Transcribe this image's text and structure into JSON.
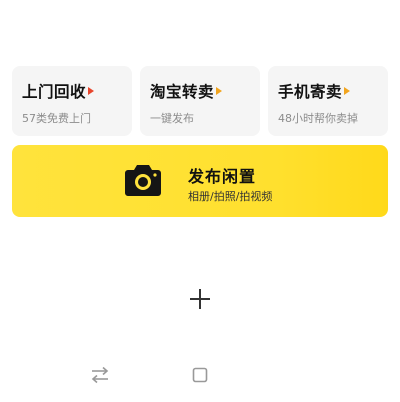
{
  "cards": [
    {
      "title": "上门回收",
      "subtitle": "57类免费上门",
      "icon": "triangle-arrow-icon",
      "color": "#e8452c"
    },
    {
      "title": "淘宝转卖",
      "subtitle": "一键发布",
      "icon": "triangle-arrow-icon",
      "color": "#f2a51f"
    },
    {
      "title": "手机寄卖",
      "subtitle": "48小时帮你卖掉",
      "icon": "triangle-arrow-icon",
      "color": "#f2a51f"
    }
  ],
  "publish": {
    "title": "发布闲置",
    "subtitle": "相册/拍照/拍视频",
    "icon": "camera-icon",
    "background": "#ffe23d"
  },
  "actions": {
    "plus_icon": "plus-icon"
  },
  "navbar": {
    "icons": [
      "switch-arrows-icon",
      "home-square-icon"
    ]
  }
}
